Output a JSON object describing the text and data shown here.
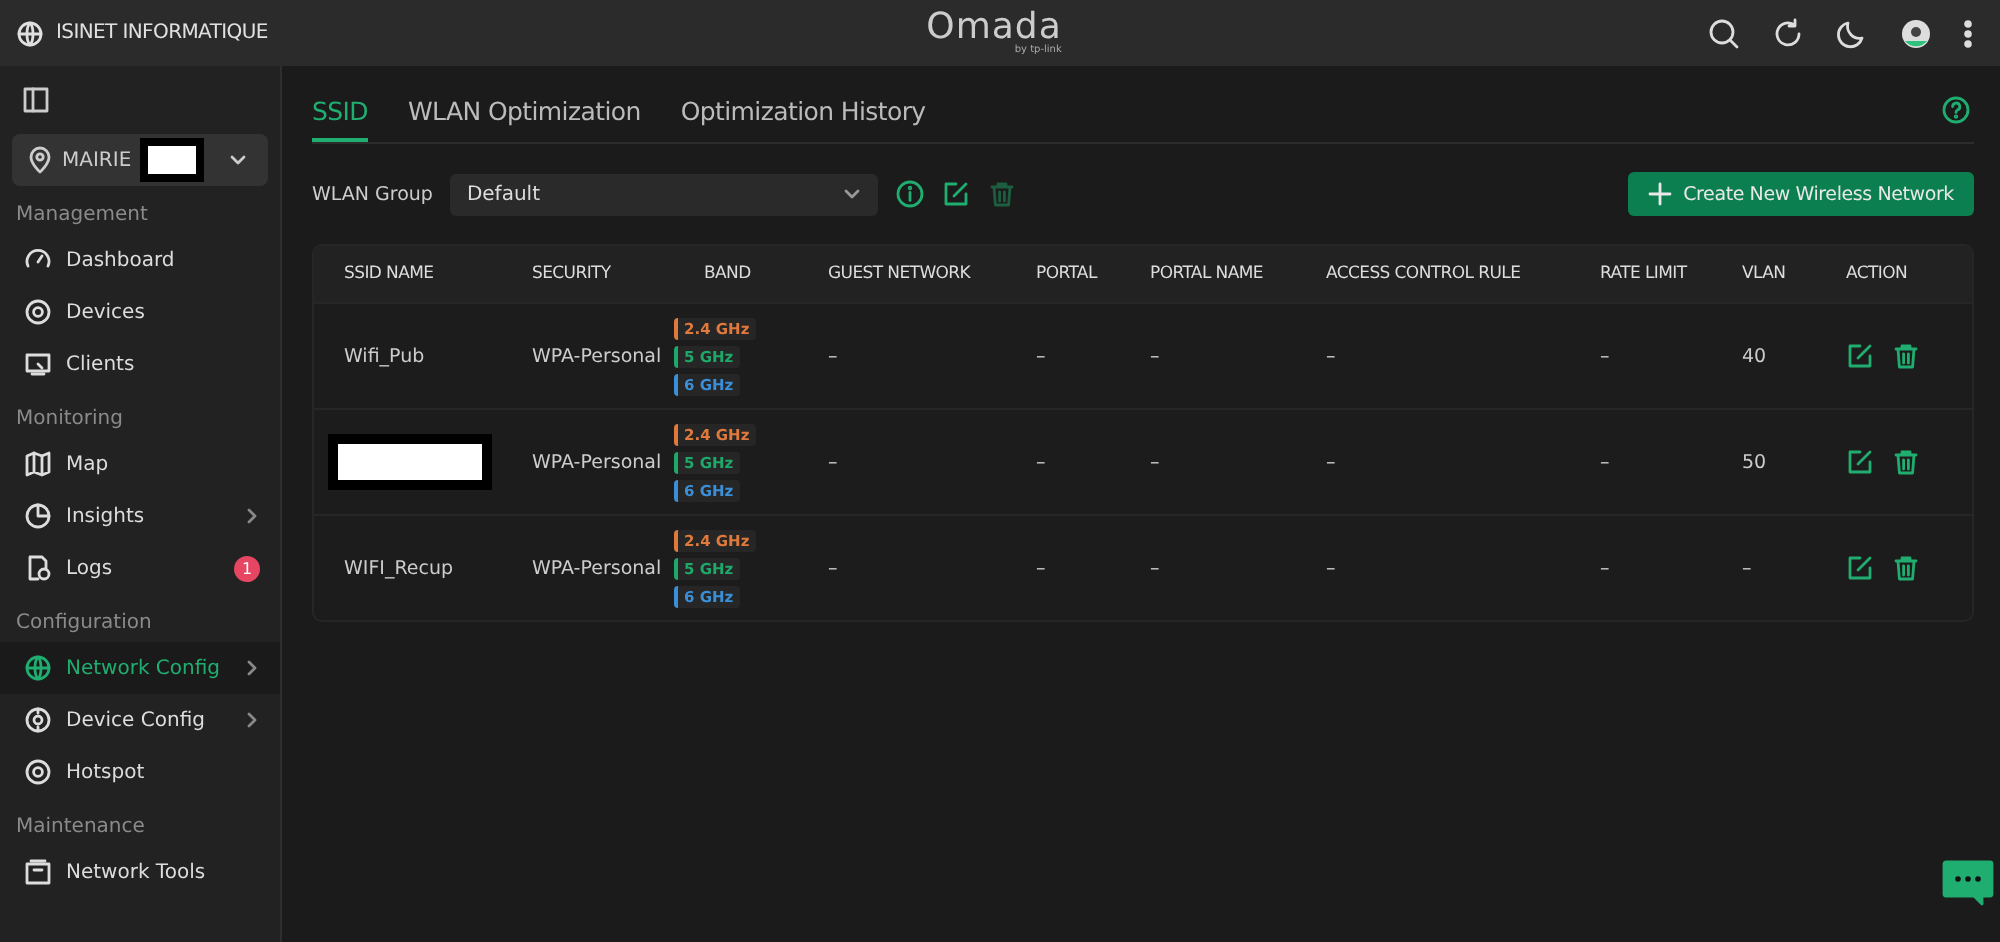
{
  "topbar": {
    "org": "ISINET INFORMATIQUE",
    "logo": "Omada",
    "logo_sub": "by tp-link"
  },
  "site": {
    "name": "MAIRIE",
    "redacted": true
  },
  "sidebar": {
    "sections": [
      {
        "title": "Management",
        "items": [
          {
            "label": "Dashboard",
            "selected": false,
            "expandable": false
          },
          {
            "label": "Devices",
            "selected": false,
            "expandable": false
          },
          {
            "label": "Clients",
            "selected": false,
            "expandable": false
          }
        ]
      },
      {
        "title": "Monitoring",
        "items": [
          {
            "label": "Map",
            "selected": false,
            "expandable": false
          },
          {
            "label": "Insights",
            "selected": false,
            "expandable": true
          },
          {
            "label": "Logs",
            "selected": false,
            "expandable": false,
            "badge": "1"
          }
        ]
      },
      {
        "title": "Configuration",
        "items": [
          {
            "label": "Network Config",
            "selected": true,
            "expandable": true
          },
          {
            "label": "Device Config",
            "selected": false,
            "expandable": true
          },
          {
            "label": "Hotspot",
            "selected": false,
            "expandable": false
          }
        ]
      },
      {
        "title": "Maintenance",
        "items": [
          {
            "label": "Network Tools",
            "selected": false,
            "expandable": false
          }
        ]
      }
    ]
  },
  "tabs": [
    {
      "label": "SSID",
      "selected": true
    },
    {
      "label": "WLAN Optimization",
      "selected": false
    },
    {
      "label": "Optimization History",
      "selected": false
    }
  ],
  "wlan_group": {
    "label": "WLAN Group",
    "value": "Default"
  },
  "create_button": "Create New Wireless Network",
  "table": {
    "columns": [
      "SSID NAME",
      "SECURITY",
      "BAND",
      "GUEST NETWORK",
      "PORTAL",
      "PORTAL NAME",
      "ACCESS CONTROL RULE",
      "RATE LIMIT",
      "VLAN",
      "ACTION"
    ],
    "rows": [
      {
        "ssid": "Wifi_Pub",
        "redacted": false,
        "security": "WPA-Personal",
        "bands": [
          {
            "label": "2.4 GHz",
            "color": "#e07a3c"
          },
          {
            "label": "5 GHz",
            "color": "#1ea86a"
          },
          {
            "label": "6 GHz",
            "color": "#3a8fd8"
          }
        ],
        "guest": "–",
        "portal": "–",
        "portal_name": "–",
        "acl": "–",
        "rate_limit": "–",
        "vlan": "40"
      },
      {
        "ssid": "",
        "redacted": true,
        "security": "WPA-Personal",
        "bands": [
          {
            "label": "2.4 GHz",
            "color": "#e07a3c"
          },
          {
            "label": "5 GHz",
            "color": "#1ea86a"
          },
          {
            "label": "6 GHz",
            "color": "#3a8fd8"
          }
        ],
        "guest": "–",
        "portal": "–",
        "portal_name": "–",
        "acl": "–",
        "rate_limit": "–",
        "vlan": "50"
      },
      {
        "ssid": "WIFI_Recup",
        "redacted": false,
        "security": "WPA-Personal",
        "bands": [
          {
            "label": "2.4 GHz",
            "color": "#e07a3c"
          },
          {
            "label": "5 GHz",
            "color": "#1ea86a"
          },
          {
            "label": "6 GHz",
            "color": "#3a8fd8"
          }
        ],
        "guest": "–",
        "portal": "–",
        "portal_name": "–",
        "acl": "–",
        "rate_limit": "–",
        "vlan": "–"
      }
    ]
  }
}
